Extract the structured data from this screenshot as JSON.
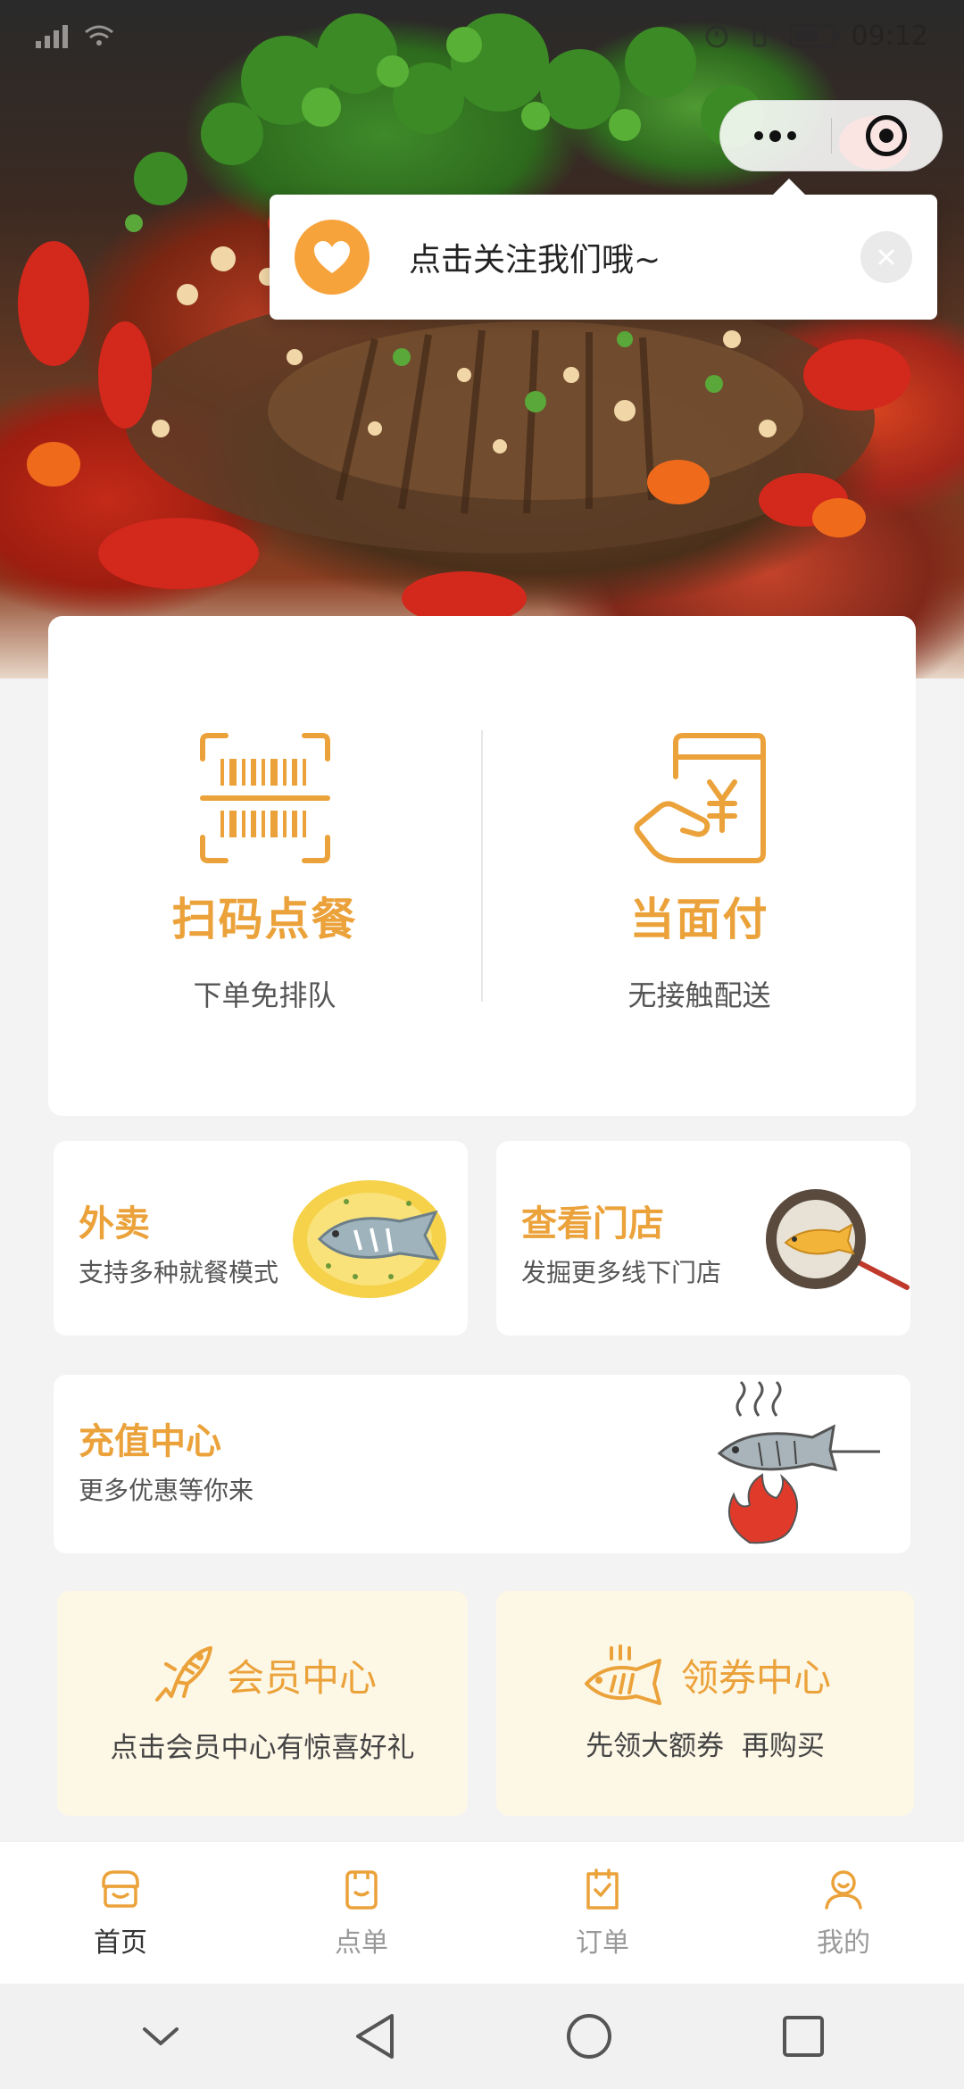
{
  "status_bar": {
    "time": "09:12"
  },
  "popup": {
    "text": "点击关注我们哦~"
  },
  "main_card": {
    "scan": {
      "title": "扫码点餐",
      "subtitle": "下单免排队"
    },
    "pay": {
      "title": "当面付",
      "subtitle": "无接触配送"
    }
  },
  "cards": {
    "takeout": {
      "title": "外卖",
      "subtitle": "支持多种就餐模式"
    },
    "stores": {
      "title": "查看门店",
      "subtitle": "发掘更多线下门店"
    },
    "recharge": {
      "title": "充值中心",
      "subtitle": "更多优惠等你来"
    },
    "member": {
      "title": "会员中心",
      "subtitle": "点击会员中心有惊喜好礼"
    },
    "coupon": {
      "title": "领券中心",
      "subtitle": "先领大额券  再购买"
    }
  },
  "tabs": [
    {
      "label": "首页",
      "active": true
    },
    {
      "label": "点单",
      "active": false
    },
    {
      "label": "订单",
      "active": false
    },
    {
      "label": "我的",
      "active": false
    }
  ],
  "colors": {
    "accent": "#eba23a",
    "popup_heart": "#f7a33c",
    "card_yellow": "#fdf7e6"
  }
}
